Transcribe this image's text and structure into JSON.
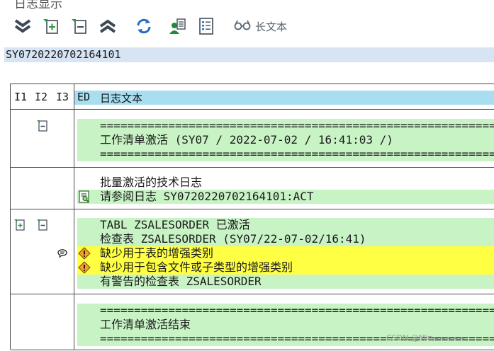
{
  "title_fragment": "日志显示",
  "toolbar": {
    "buttons": [
      {
        "name": "expand-all-button",
        "icon": "double-chevron-down-icon"
      },
      {
        "name": "expand-node-button",
        "icon": "expand-node-icon"
      },
      {
        "name": "collapse-node-button",
        "icon": "collapse-node-icon"
      },
      {
        "name": "collapse-all-button",
        "icon": "double-chevron-up-icon"
      },
      {
        "name": "refresh-button",
        "icon": "refresh-icon"
      },
      {
        "name": "select-user-button",
        "icon": "user-select-icon"
      },
      {
        "name": "details-button",
        "icon": "document-list-icon"
      }
    ],
    "long_text_label": "长文本"
  },
  "log_id": "SY0720220702164101",
  "table": {
    "headers": [
      "I1",
      "I2",
      "I3",
      "ED",
      "日志文本"
    ],
    "rows": [
      {
        "kind": "separator",
        "text": "================================================================================================"
      },
      {
        "kind": "heading",
        "text": "工作清单激活 (SY07 / 2022-07-02 / 16:41:03 /)"
      },
      {
        "kind": "separator",
        "text": "================================================================================================"
      },
      {
        "kind": "plain",
        "text": "批量激活的技术日志"
      },
      {
        "kind": "reference",
        "text": "请参阅日志 SY0720220702164101:ACT"
      },
      {
        "kind": "info",
        "text": "TABL ZSALESORDER 已激活"
      },
      {
        "kind": "info",
        "text": "检查表 ZSALESORDER (SY07/22-07-02/16:41)"
      },
      {
        "kind": "warning",
        "text": "缺少用于表的增强类别"
      },
      {
        "kind": "warning",
        "text": "缺少用于包含文件或子类型的增强类别"
      },
      {
        "kind": "info",
        "text": "有警告的检查表 ZSALESORDER"
      },
      {
        "kind": "separator",
        "text": "================================================================================================"
      },
      {
        "kind": "heading",
        "text": "工作清单激活结束"
      },
      {
        "kind": "separator",
        "text": "================================================================================================"
      }
    ]
  },
  "watermark": "CSDN @Min=====",
  "colors": {
    "header_bg": "#a9def0",
    "row_green": "#c8f3c5",
    "row_yellow": "#ffff44",
    "log_id_bg": "#d6e4f3"
  }
}
